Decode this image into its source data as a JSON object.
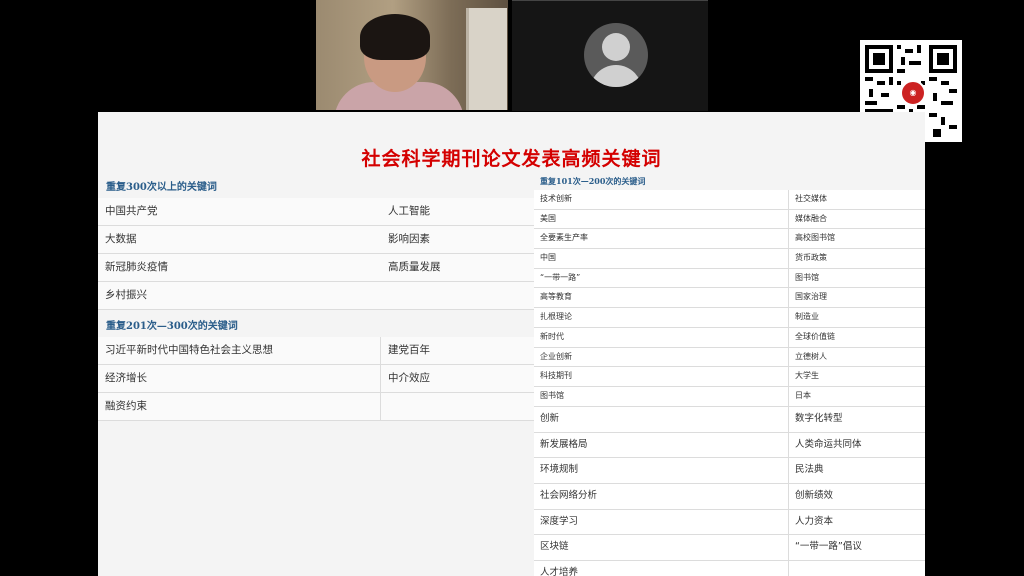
{
  "slide": {
    "title": "社会科学期刊论文发表高频关键词",
    "left_section1_heading": "重复300次以上的关键词",
    "left_section1_items": [
      "中国共产党",
      "人工智能",
      "大数据",
      "影响因素",
      "新冠肺炎疫情",
      "高质量发展",
      "乡村振兴",
      ""
    ],
    "left_section2_heading": "重复201次—300次的关键词",
    "left_section2_items": [
      "习近平新时代中国特色社会主义思想",
      "建党百年",
      "经济增长",
      "中介效应",
      "融资约束",
      ""
    ],
    "right_section_heading": "重复101次—200次的关键词",
    "right_small_items": [
      "技术创新",
      "社交媒体",
      "美国",
      "媒体融合",
      "全要素生产率",
      "高校图书馆",
      "中国",
      "货币政策",
      "“一带一路”",
      "图书馆",
      "高等教育",
      "国家治理",
      "扎根理论",
      "制造业",
      "新时代",
      "全球价值链",
      "企业创新",
      "立德树人",
      "科技期刊",
      "大学生",
      "图书馆",
      "日本"
    ],
    "right_large_items": [
      "创新",
      "数字化转型",
      "新发展格局",
      "人类命运共同体",
      "环境规制",
      "民法典",
      "社会网络分析",
      "创新绩效",
      "深度学习",
      "人力资本",
      "区块链",
      "“一带一路”倡议",
      "人才培养",
      ""
    ]
  },
  "icons": {
    "qr": "qr-code-icon",
    "avatar": "user-avatar-icon"
  }
}
